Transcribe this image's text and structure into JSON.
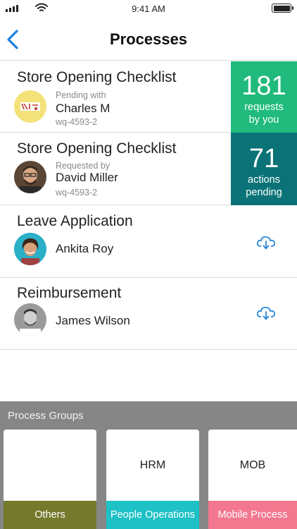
{
  "status_bar": {
    "time": "9:41 AM"
  },
  "nav": {
    "title": "Processes"
  },
  "processes": [
    {
      "title": "Store Opening Checklist",
      "status_label": "Pending with",
      "person": "Charles M",
      "id": "wq-4593-2"
    },
    {
      "title": "Store Opening Checklist",
      "status_label": "Requested by",
      "person": "David Miller",
      "id": "wq-4593-2"
    },
    {
      "title": "Leave Application",
      "person": "Ankita Roy"
    },
    {
      "title": "Reimbursement",
      "person": "James Wilson"
    }
  ],
  "stats": [
    {
      "value": "181",
      "label_line1": "requests",
      "label_line2": "by you",
      "color": "#1fba7c"
    },
    {
      "value": "71",
      "label_line1": "actions",
      "label_line2": "pending",
      "color": "#0b7377"
    }
  ],
  "process_groups": {
    "title": "Process Groups",
    "items": [
      {
        "code": "",
        "name": "Others",
        "color": "#75792c"
      },
      {
        "code": "HRM",
        "name": "People Operations",
        "color": "#1dc1c6"
      },
      {
        "code": "MOB",
        "name": "Mobile Process",
        "color": "#f2778f"
      }
    ]
  },
  "colors": {
    "accent": "#1a7fe0",
    "download_icon": "#2a87d8"
  }
}
